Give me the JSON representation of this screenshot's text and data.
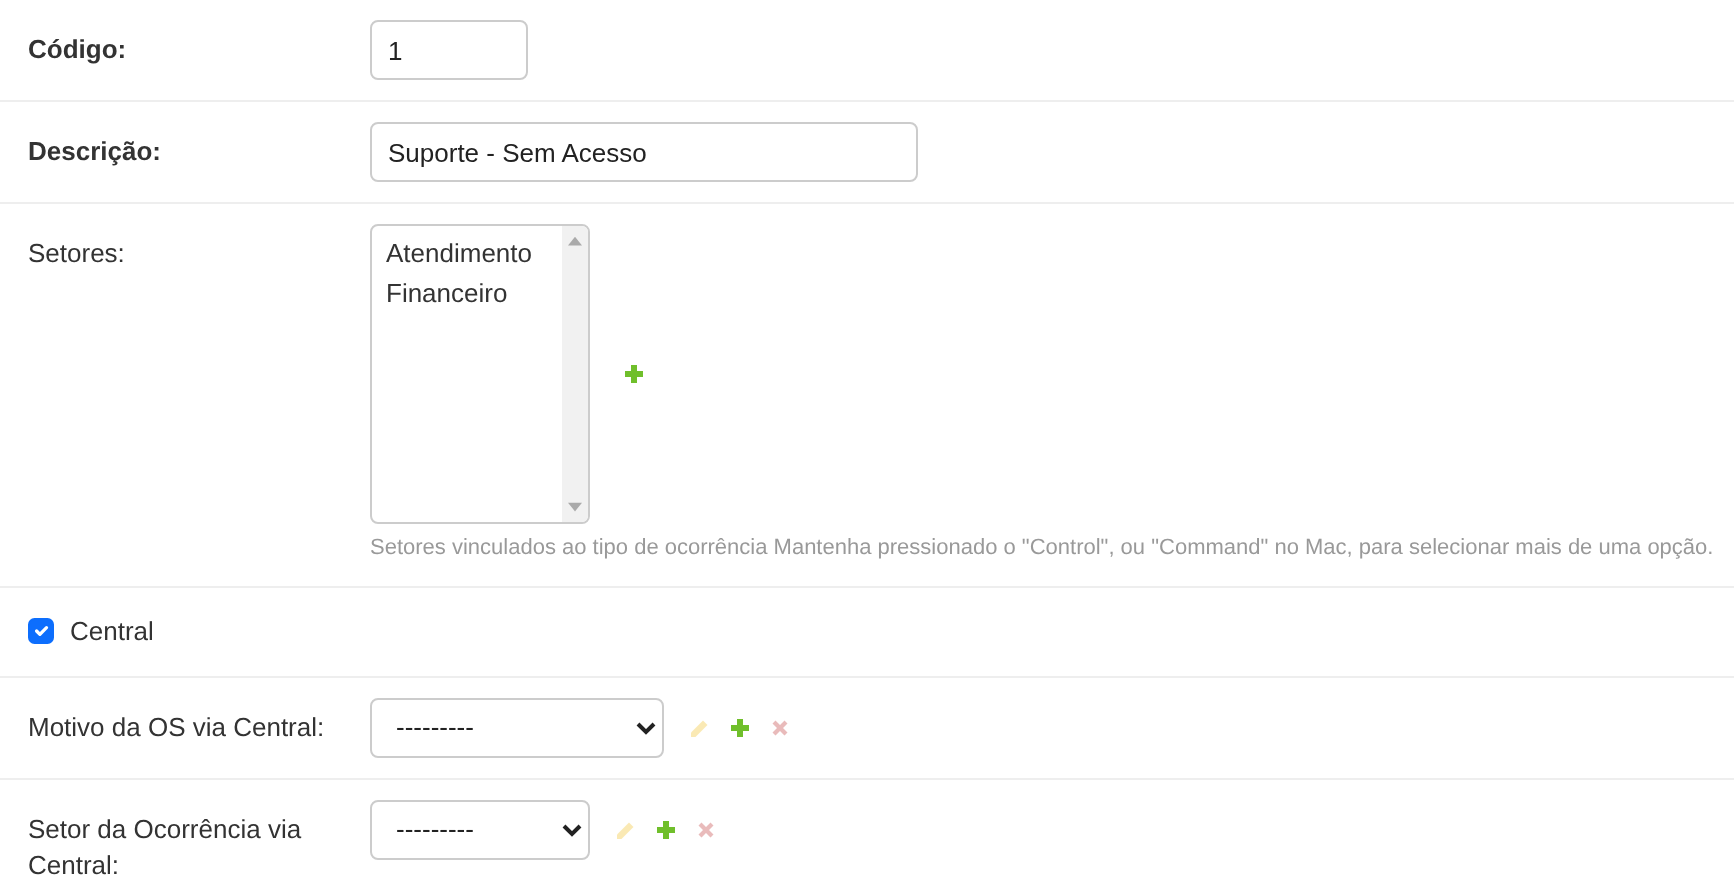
{
  "fields": [
    {
      "kind": "number",
      "label": "Código:",
      "required": true,
      "value": "1"
    },
    {
      "kind": "text",
      "label": "Descrição:",
      "required": true,
      "value": "Suporte - Sem Acesso"
    },
    {
      "kind": "multiselect",
      "label": "Setores:",
      "required": false,
      "options": [
        "Atendimento",
        "Financeiro"
      ],
      "help": "Setores vinculados ao tipo de ocorrência Mantenha pressionado o \"Control\", ou \"Command\" no Mac, para selecionar mais de uma opção.",
      "actions": [
        {
          "kind": "add",
          "disabled": false
        }
      ]
    },
    {
      "kind": "checkbox",
      "label": "Central",
      "checked": true
    },
    {
      "kind": "select",
      "label": "Motivo da OS via Central:",
      "required": false,
      "value": "---------",
      "actions": [
        {
          "kind": "edit",
          "disabled": true
        },
        {
          "kind": "add",
          "disabled": false
        },
        {
          "kind": "delete",
          "disabled": true
        }
      ]
    },
    {
      "kind": "select",
      "label": "Setor da Ocorrência via Central:",
      "required": false,
      "value": "---------",
      "actions": [
        {
          "kind": "edit",
          "disabled": true
        },
        {
          "kind": "add",
          "disabled": false
        },
        {
          "kind": "delete",
          "disabled": true
        }
      ]
    }
  ]
}
